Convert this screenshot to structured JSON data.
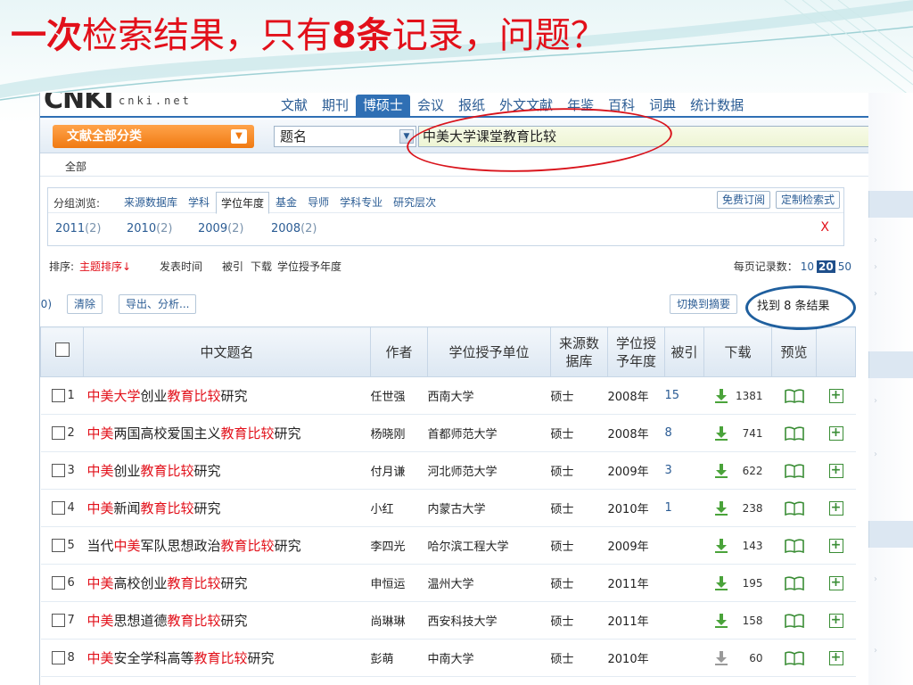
{
  "slide": {
    "title_part1": "一次",
    "title_part2": "检索结果，只有",
    "title_part3": "8条",
    "title_part4": "记录，问题？"
  },
  "site": {
    "logo_mark": "CNKI",
    "logo_text": "cnki.net",
    "nav_tabs": [
      "文献",
      "期刊",
      "博硕士",
      "会议",
      "报纸",
      "外文文献",
      "年鉴",
      "百科",
      "词典",
      "统计数据"
    ],
    "active_tab": "博硕士"
  },
  "search": {
    "category_button": "文献全部分类",
    "field": "题名",
    "query": "中美大学课堂教育比较",
    "scope": "全部"
  },
  "grouping": {
    "label": "分组浏览:",
    "tabs": [
      "来源数据库",
      "学科",
      "学位年度",
      "基金",
      "导师",
      "学科专业",
      "研究层次"
    ],
    "active": "学位年度",
    "subscribe_button": "免费订阅",
    "custom_button": "定制检索式",
    "years": [
      {
        "year": "2011",
        "count": "(2)"
      },
      {
        "year": "2010",
        "count": "(2)"
      },
      {
        "year": "2009",
        "count": "(2)"
      },
      {
        "year": "2008",
        "count": "(2)"
      }
    ],
    "close": "X"
  },
  "sort": {
    "label": "排序:",
    "options": [
      "主题排序↓",
      "发表时间",
      "被引",
      "下载",
      "学位授予年度"
    ],
    "active": "主题排序↓",
    "per_page_label": "每页记录数：",
    "per_page_options": [
      "10",
      "20",
      "50"
    ],
    "per_page_selected": "20"
  },
  "actions": {
    "selected_count": "(0)",
    "clear": "清除",
    "export": "导出、分析...",
    "switch_abstract": "切换到摘要",
    "found": "找到 8 条结果"
  },
  "table": {
    "headers": {
      "title": "中文题名",
      "author": "作者",
      "unit": "学位授予单位",
      "db_line1": "来源数",
      "db_line2": "据库",
      "year_line1": "学位授",
      "year_line2": "予年度",
      "cited": "被引",
      "download": "下载",
      "preview": "预览"
    },
    "rows": [
      {
        "n": "1",
        "t": [
          [
            "中美大学",
            1
          ],
          [
            "创业",
            0
          ],
          [
            "教育比较",
            1
          ],
          [
            "研究",
            0
          ]
        ],
        "author": "任世强",
        "unit": "西南大学",
        "db": "硕士",
        "year": "2008年",
        "cited": "15",
        "dl": "1381",
        "dl_active": true
      },
      {
        "n": "2",
        "t": [
          [
            "中美",
            1
          ],
          [
            "两国高校爱国主义",
            0
          ],
          [
            "教育比较",
            1
          ],
          [
            "研究",
            0
          ]
        ],
        "author": "杨晓刚",
        "unit": "首都师范大学",
        "db": "硕士",
        "year": "2008年",
        "cited": "8",
        "dl": "741",
        "dl_active": true
      },
      {
        "n": "3",
        "t": [
          [
            "中美",
            1
          ],
          [
            "创业",
            0
          ],
          [
            "教育比较",
            1
          ],
          [
            "研究",
            0
          ]
        ],
        "author": "付月谦",
        "unit": "河北师范大学",
        "db": "硕士",
        "year": "2009年",
        "cited": "3",
        "dl": "622",
        "dl_active": true
      },
      {
        "n": "4",
        "t": [
          [
            "中美",
            1
          ],
          [
            "新闻",
            0
          ],
          [
            "教育比较",
            1
          ],
          [
            "研究",
            0
          ]
        ],
        "author": "小红",
        "unit": "内蒙古大学",
        "db": "硕士",
        "year": "2010年",
        "cited": "1",
        "dl": "238",
        "dl_active": true
      },
      {
        "n": "5",
        "t": [
          [
            "当代",
            0
          ],
          [
            "中美",
            1
          ],
          [
            "军队思想政治",
            0
          ],
          [
            "教育比较",
            1
          ],
          [
            "研究",
            0
          ]
        ],
        "author": "李四光",
        "unit": "哈尔滨工程大学",
        "db": "硕士",
        "year": "2009年",
        "cited": "",
        "dl": "143",
        "dl_active": true
      },
      {
        "n": "6",
        "t": [
          [
            "中美",
            1
          ],
          [
            "高校创业",
            0
          ],
          [
            "教育比较",
            1
          ],
          [
            "研究",
            0
          ]
        ],
        "author": "申恒运",
        "unit": "温州大学",
        "db": "硕士",
        "year": "2011年",
        "cited": "",
        "dl": "195",
        "dl_active": true
      },
      {
        "n": "7",
        "t": [
          [
            "中美",
            1
          ],
          [
            "思想道德",
            0
          ],
          [
            "教育比较",
            1
          ],
          [
            "研究",
            0
          ]
        ],
        "author": "尚琳琳",
        "unit": "西安科技大学",
        "db": "硕士",
        "year": "2011年",
        "cited": "",
        "dl": "158",
        "dl_active": true
      },
      {
        "n": "8",
        "t": [
          [
            "中美",
            1
          ],
          [
            "安全学科高等",
            0
          ],
          [
            "教育比较",
            1
          ],
          [
            "研究",
            0
          ]
        ],
        "author": "彭萌",
        "unit": "中南大学",
        "db": "硕士",
        "year": "2010年",
        "cited": "",
        "dl": "60",
        "dl_active": false
      }
    ]
  },
  "colors": {
    "highlight": "#e2101a",
    "link": "#2b5c94",
    "accent_orange": "#f07a12",
    "download_green": "#4aa33a"
  }
}
